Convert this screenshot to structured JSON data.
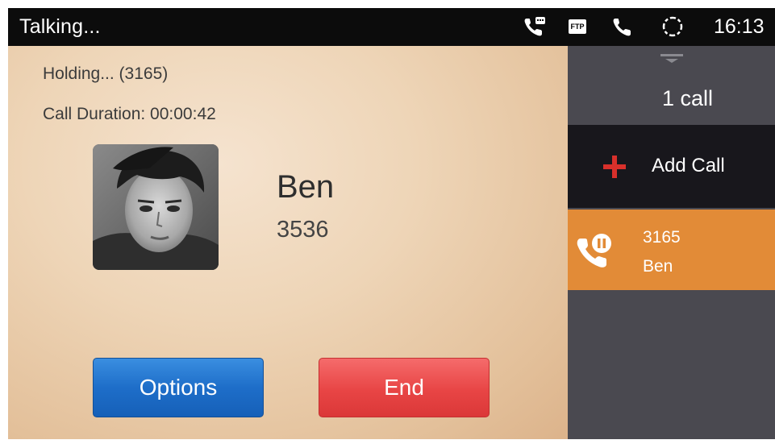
{
  "status_bar": {
    "title": "Talking...",
    "ftp_badge": "FTP",
    "time": "16:13",
    "icons": [
      "voicemail-call-icon",
      "ftp-icon",
      "phone-icon",
      "sync-icon"
    ]
  },
  "call": {
    "holding_text": "Holding... (3165)",
    "duration_text": "Call Duration: 00:00:42",
    "contact_name": "Ben",
    "contact_number": "3536"
  },
  "buttons": {
    "options_label": "Options",
    "end_label": "End"
  },
  "side_panel": {
    "call_count": "1 call",
    "add_call_label": "Add Call",
    "held_call": {
      "number": "3165",
      "name": "Ben"
    }
  },
  "colors": {
    "status_bar_bg": "#0c0c0c",
    "side_panel_bg": "#4a4950",
    "add_call_bg": "#18171c",
    "held_call_bg": "#e28b37",
    "options_button": "#1e6ec9",
    "end_button": "#e84545",
    "plus_icon": "#d8302b"
  }
}
